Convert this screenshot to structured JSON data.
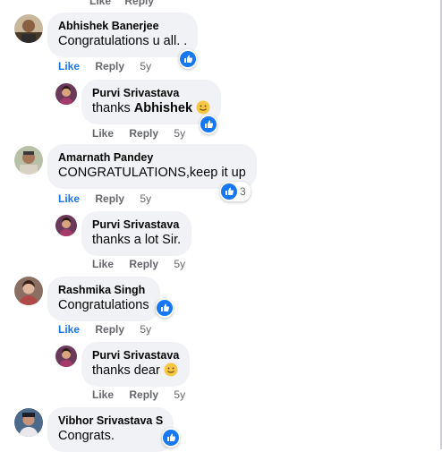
{
  "top_actions": {
    "like": "Like",
    "reply": "Reply"
  },
  "comments": [
    {
      "author": "Abhishek Banerjee",
      "text": "Congratulations u all. .",
      "like": "Like",
      "reply": "Reply",
      "time": "5y",
      "reaction_count": ""
    },
    {
      "author": "Purvi Srivastava",
      "text_prefix": "thanks ",
      "mention": "Abhishek",
      "like": "Like",
      "reply": "Reply",
      "time": "5y",
      "reaction_count": ""
    },
    {
      "author": "Amarnath Pandey",
      "text": "CONGRATULATIONS,keep it up",
      "like": "Like",
      "reply": "Reply",
      "time": "5y",
      "reaction_count": "3"
    },
    {
      "author": "Purvi Srivastava",
      "text": "thanks a lot Sir.",
      "like": "Like",
      "reply": "Reply",
      "time": "5y"
    },
    {
      "author": "Rashmika Singh",
      "text": "Congratulations",
      "like": "Like",
      "reply": "Reply",
      "time": "5y",
      "reaction_count": ""
    },
    {
      "author": "Purvi Srivastava",
      "text": "thanks dear",
      "like": "Like",
      "reply": "Reply",
      "time": "5y"
    },
    {
      "author": "Vibhor Srivastava S",
      "text": "Congrats.",
      "reaction_count": ""
    }
  ],
  "colors": {
    "bubble": "#f0f2f5",
    "like_blue": "#1877f2",
    "meta_gray": "#65676b"
  }
}
